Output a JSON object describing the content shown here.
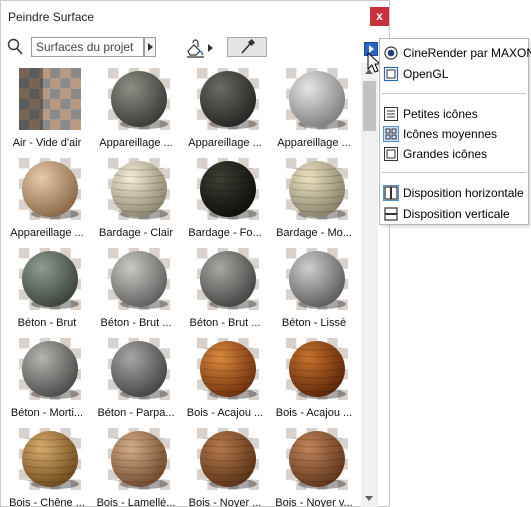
{
  "window": {
    "title": "Peindre Surface",
    "close_label": "x"
  },
  "toolbar": {
    "combo_value": "Surfaces du projet"
  },
  "tiles": [
    {
      "label": "Air - Vide d'air",
      "icon": "checker-corner-swatch"
    },
    {
      "label": "Appareillage ...",
      "icon": "stone-sphere"
    },
    {
      "label": "Appareillage ...",
      "icon": "stone-sphere"
    },
    {
      "label": "Appareillage ...",
      "icon": "stone-sphere"
    },
    {
      "label": "Appareillage ...",
      "icon": "brick-sphere"
    },
    {
      "label": "Bardage - Clair",
      "icon": "siding-sphere"
    },
    {
      "label": "Bardage - Fo...",
      "icon": "siding-sphere"
    },
    {
      "label": "Bardage - Mo...",
      "icon": "siding-sphere"
    },
    {
      "label": "Béton - Brut",
      "icon": "concrete-sphere"
    },
    {
      "label": "Béton - Brut ...",
      "icon": "concrete-sphere"
    },
    {
      "label": "Béton - Brut ...",
      "icon": "concrete-sphere"
    },
    {
      "label": "Béton - Lissé",
      "icon": "concrete-sphere"
    },
    {
      "label": "Béton - Morti...",
      "icon": "concrete-sphere"
    },
    {
      "label": "Béton - Parpa...",
      "icon": "block-sphere"
    },
    {
      "label": "Bois - Acajou ...",
      "icon": "wood-sphere"
    },
    {
      "label": "Bois - Acajou ...",
      "icon": "wood-sphere"
    },
    {
      "label": "Bois - Chêne ...",
      "icon": "wood-sphere"
    },
    {
      "label": "Bois - Lamellé...",
      "icon": "wood-sphere"
    },
    {
      "label": "Bois - Noyer ...",
      "icon": "wood-sphere"
    },
    {
      "label": "Bois - Noyer v...",
      "icon": "wood-sphere"
    }
  ],
  "menu": {
    "items": [
      {
        "label": "CineRender par MAXON",
        "icon": "radio-icon",
        "selected": true
      },
      {
        "label": "OpenGL",
        "icon": "opengl-icon",
        "selected": false
      },
      {
        "label": "Petites icônes",
        "icon": "small-icons-icon",
        "selected": false
      },
      {
        "label": "Icônes moyennes",
        "icon": "medium-icons-icon",
        "selected": true
      },
      {
        "label": "Grandes icônes",
        "icon": "large-icons-icon",
        "selected": false
      },
      {
        "label": "Disposition horizontale",
        "icon": "horizontal-layout-icon",
        "selected": true
      },
      {
        "label": "Disposition verticale",
        "icon": "vertical-layout-icon",
        "selected": false
      }
    ]
  },
  "colors": {
    "close": "#c8313b",
    "accent": "#2b66c6",
    "selection": "#cfe2f8"
  }
}
